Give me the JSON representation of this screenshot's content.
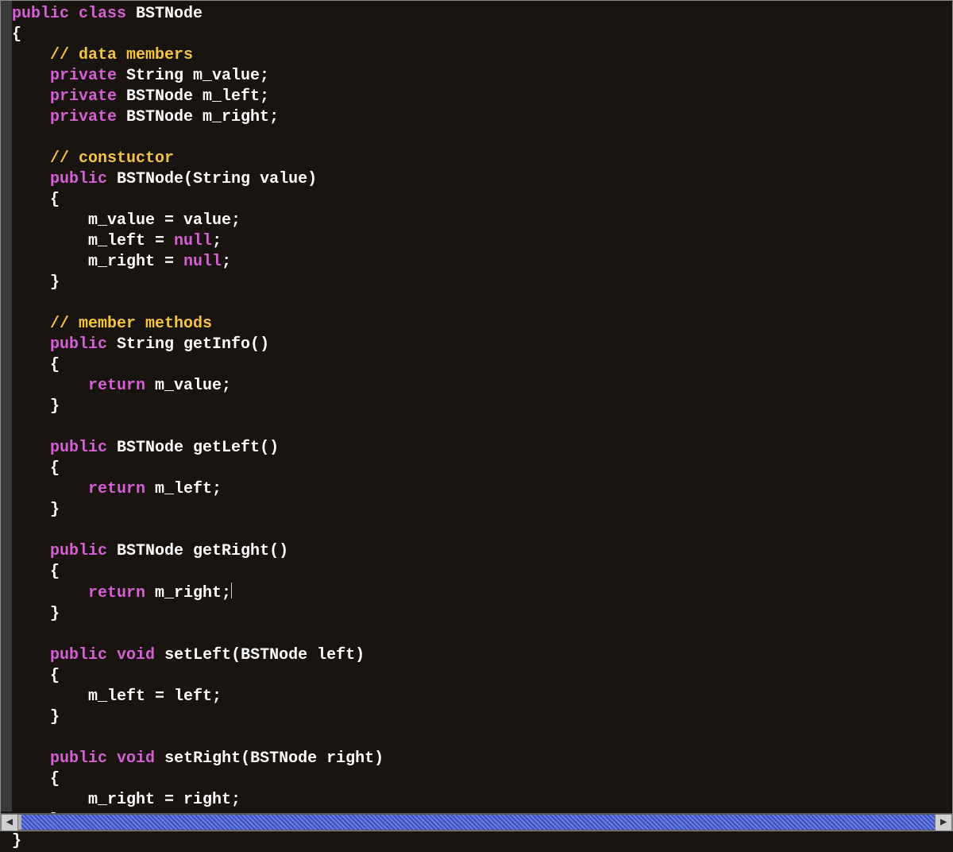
{
  "code": {
    "lines": [
      {
        "segments": [
          {
            "t": "public",
            "c": "kw"
          },
          {
            "t": " ",
            "c": "plain"
          },
          {
            "t": "class",
            "c": "kw"
          },
          {
            "t": " BSTNode",
            "c": "plain"
          }
        ]
      },
      {
        "segments": [
          {
            "t": "{",
            "c": "plain"
          }
        ]
      },
      {
        "segments": [
          {
            "t": "    ",
            "c": "plain"
          },
          {
            "t": "// data members",
            "c": "comment"
          }
        ]
      },
      {
        "segments": [
          {
            "t": "    ",
            "c": "plain"
          },
          {
            "t": "private",
            "c": "kw"
          },
          {
            "t": " String m_value;",
            "c": "plain"
          }
        ]
      },
      {
        "segments": [
          {
            "t": "    ",
            "c": "plain"
          },
          {
            "t": "private",
            "c": "kw"
          },
          {
            "t": " BSTNode m_left;",
            "c": "plain"
          }
        ]
      },
      {
        "segments": [
          {
            "t": "    ",
            "c": "plain"
          },
          {
            "t": "private",
            "c": "kw"
          },
          {
            "t": " BSTNode m_right;",
            "c": "plain"
          }
        ]
      },
      {
        "segments": [
          {
            "t": "",
            "c": "plain"
          }
        ]
      },
      {
        "segments": [
          {
            "t": "    ",
            "c": "plain"
          },
          {
            "t": "// constuctor",
            "c": "comment"
          }
        ]
      },
      {
        "segments": [
          {
            "t": "    ",
            "c": "plain"
          },
          {
            "t": "public",
            "c": "kw"
          },
          {
            "t": " BSTNode(String value)",
            "c": "plain"
          }
        ]
      },
      {
        "segments": [
          {
            "t": "    {",
            "c": "plain"
          }
        ]
      },
      {
        "segments": [
          {
            "t": "        m_value = value;",
            "c": "plain"
          }
        ]
      },
      {
        "segments": [
          {
            "t": "        m_left = ",
            "c": "plain"
          },
          {
            "t": "null",
            "c": "kw"
          },
          {
            "t": ";",
            "c": "plain"
          }
        ]
      },
      {
        "segments": [
          {
            "t": "        m_right = ",
            "c": "plain"
          },
          {
            "t": "null",
            "c": "kw"
          },
          {
            "t": ";",
            "c": "plain"
          }
        ]
      },
      {
        "segments": [
          {
            "t": "    }",
            "c": "plain"
          }
        ]
      },
      {
        "segments": [
          {
            "t": "",
            "c": "plain"
          }
        ]
      },
      {
        "segments": [
          {
            "t": "    ",
            "c": "plain"
          },
          {
            "t": "// member methods",
            "c": "comment"
          }
        ]
      },
      {
        "segments": [
          {
            "t": "    ",
            "c": "plain"
          },
          {
            "t": "public",
            "c": "kw"
          },
          {
            "t": " String getInfo()",
            "c": "plain"
          }
        ]
      },
      {
        "segments": [
          {
            "t": "    {",
            "c": "plain"
          }
        ]
      },
      {
        "segments": [
          {
            "t": "        ",
            "c": "plain"
          },
          {
            "t": "return",
            "c": "kw"
          },
          {
            "t": " m_value;",
            "c": "plain"
          }
        ]
      },
      {
        "segments": [
          {
            "t": "    }",
            "c": "plain"
          }
        ]
      },
      {
        "segments": [
          {
            "t": "",
            "c": "plain"
          }
        ]
      },
      {
        "segments": [
          {
            "t": "    ",
            "c": "plain"
          },
          {
            "t": "public",
            "c": "kw"
          },
          {
            "t": " BSTNode getLeft()",
            "c": "plain"
          }
        ]
      },
      {
        "segments": [
          {
            "t": "    {",
            "c": "plain"
          }
        ]
      },
      {
        "segments": [
          {
            "t": "        ",
            "c": "plain"
          },
          {
            "t": "return",
            "c": "kw"
          },
          {
            "t": " m_left;",
            "c": "plain"
          }
        ]
      },
      {
        "segments": [
          {
            "t": "    }",
            "c": "plain"
          }
        ]
      },
      {
        "segments": [
          {
            "t": "",
            "c": "plain"
          }
        ]
      },
      {
        "segments": [
          {
            "t": "    ",
            "c": "plain"
          },
          {
            "t": "public",
            "c": "kw"
          },
          {
            "t": " BSTNode getRight()",
            "c": "plain"
          }
        ]
      },
      {
        "segments": [
          {
            "t": "    {",
            "c": "plain"
          }
        ]
      },
      {
        "segments": [
          {
            "t": "        ",
            "c": "plain"
          },
          {
            "t": "return",
            "c": "kw"
          },
          {
            "t": " m_right;",
            "c": "plain"
          }
        ],
        "cursorAfter": true
      },
      {
        "segments": [
          {
            "t": "    }",
            "c": "plain"
          }
        ]
      },
      {
        "segments": [
          {
            "t": "",
            "c": "plain"
          }
        ]
      },
      {
        "segments": [
          {
            "t": "    ",
            "c": "plain"
          },
          {
            "t": "public",
            "c": "kw"
          },
          {
            "t": " ",
            "c": "plain"
          },
          {
            "t": "void",
            "c": "kw"
          },
          {
            "t": " setLeft(BSTNode left)",
            "c": "plain"
          }
        ]
      },
      {
        "segments": [
          {
            "t": "    {",
            "c": "plain"
          }
        ]
      },
      {
        "segments": [
          {
            "t": "        m_left = left;",
            "c": "plain"
          }
        ]
      },
      {
        "segments": [
          {
            "t": "    }",
            "c": "plain"
          }
        ]
      },
      {
        "segments": [
          {
            "t": "",
            "c": "plain"
          }
        ]
      },
      {
        "segments": [
          {
            "t": "    ",
            "c": "plain"
          },
          {
            "t": "public",
            "c": "kw"
          },
          {
            "t": " ",
            "c": "plain"
          },
          {
            "t": "void",
            "c": "kw"
          },
          {
            "t": " setRight(BSTNode right)",
            "c": "plain"
          }
        ]
      },
      {
        "segments": [
          {
            "t": "    {",
            "c": "plain"
          }
        ]
      },
      {
        "segments": [
          {
            "t": "        m_right = right;",
            "c": "plain"
          }
        ]
      },
      {
        "segments": [
          {
            "t": "    }",
            "c": "plain"
          }
        ]
      },
      {
        "segments": [
          {
            "t": "}",
            "c": "plain"
          }
        ]
      }
    ]
  },
  "scrollbar": {
    "leftArrow": "◀",
    "rightArrow": "▶"
  }
}
